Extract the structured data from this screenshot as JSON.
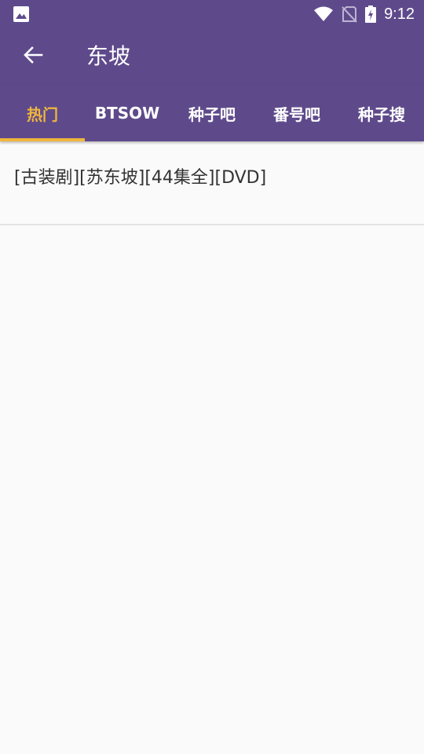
{
  "status_bar": {
    "left_icon": "image-icon",
    "right_icons": [
      "wifi-icon",
      "no-sim-icon",
      "battery-charging-icon"
    ],
    "time": "9:12"
  },
  "app_bar": {
    "back_icon": "arrow-back-icon",
    "title": "东坡"
  },
  "tabs": [
    {
      "label": "热门",
      "active": true
    },
    {
      "label": "BTSOW",
      "active": false
    },
    {
      "label": "种子吧",
      "active": false
    },
    {
      "label": "番号吧",
      "active": false
    },
    {
      "label": "种子搜",
      "active": false
    }
  ],
  "results": [
    {
      "title": "[古装剧][苏东坡][44集全][DVD]"
    }
  ],
  "colors": {
    "primary": "#5e4a8b",
    "accent": "#f0b63c",
    "background": "#fafafa",
    "divider": "#e3e3e3"
  }
}
